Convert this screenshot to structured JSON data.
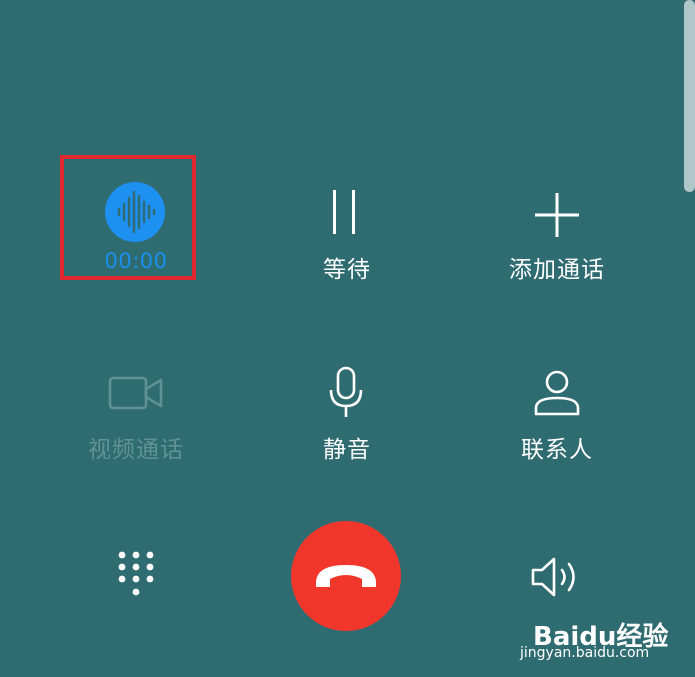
{
  "recorder": {
    "time": "00:00"
  },
  "controls": {
    "hold": "等待",
    "add_call": "添加通话",
    "video_call": "视频通话",
    "mute": "静音",
    "contacts": "联系人"
  },
  "icons": {
    "recorder": "waveform-icon",
    "hold": "pause-icon",
    "add_call": "plus-icon",
    "video_call": "video-camera-icon",
    "mute": "microphone-icon",
    "contacts": "person-icon",
    "dialpad": "dialpad-icon",
    "end_call": "phone-hangup-icon",
    "speaker": "speaker-icon"
  },
  "colors": {
    "background": "#2f6c72",
    "recorder_accent": "#1e90f2",
    "end_call": "#f1372b",
    "highlight_box": "#e02a2f",
    "disabled_text": "#5f9195"
  },
  "watermark": {
    "logo": "Baidu经验",
    "url": "jingyan.baidu.com"
  }
}
